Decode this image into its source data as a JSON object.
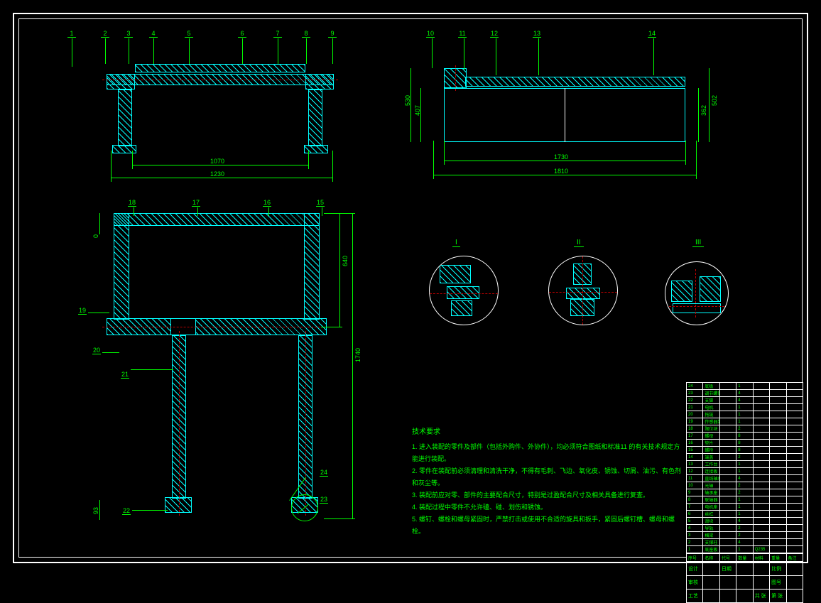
{
  "domain": "Diagram",
  "view_dimensions": {
    "front": {
      "width": "1070",
      "width_overall": "1230"
    },
    "side": {
      "width_inner": "1730",
      "width_overall": "1810",
      "h1": "407",
      "h2": "530",
      "h3": "362",
      "h4": "502"
    },
    "top": {
      "height_overall": "1740",
      "gap": "640",
      "x0": "0",
      "x1": "93"
    }
  },
  "leaders": {
    "front": [
      "1",
      "2",
      "3",
      "4",
      "5",
      "6",
      "7",
      "8",
      "9"
    ],
    "side": [
      "10",
      "11",
      "12",
      "13",
      "14"
    ],
    "top_upper": [
      "18",
      "17",
      "16",
      "15"
    ],
    "top_left": [
      "19",
      "20",
      "21",
      "22"
    ],
    "top_lower_right": [
      "24",
      "23"
    ]
  },
  "detail_labels": [
    "I",
    "II",
    "III"
  ],
  "notes": {
    "title": "技术要求",
    "lines": [
      "1. 进入装配的零件及部件（包括外购件、外协件），均必须符合图纸和标准11 的有关技术规定方能进行装配。",
      "2. 零件在装配前必须清理和清洗干净，不得有毛刺、飞边、氧化皮、锈蚀、切屑、油污、有色剂和灰尘等。",
      "3. 装配前应对零、部件的主要配合尺寸，特别是过盈配合尺寸及相关具备进行复查。",
      "4. 装配过程中零件不允许磕、碰、划伤和锈蚀。",
      "5. 螺钉、螺栓和螺母紧固时，严禁打击或使用不合适的旋具和扳手，紧固后螺钉槽、螺母和螺栓。"
    ]
  },
  "title_block": {
    "bom_rows": [
      [
        "1",
        "底座板",
        "",
        "1",
        "Q235",
        "",
        ""
      ],
      [
        "2",
        "支撑柱",
        "",
        "4",
        "",
        "",
        ""
      ],
      [
        "3",
        "横梁",
        "",
        "2",
        "",
        "",
        ""
      ],
      [
        "4",
        "导轨",
        "",
        "2",
        "",
        "",
        ""
      ],
      [
        "5",
        "滑块",
        "",
        "4",
        "",
        "",
        ""
      ],
      [
        "6",
        "丝杠",
        "",
        "1",
        "",
        "",
        ""
      ],
      [
        "7",
        "电机座",
        "",
        "1",
        "",
        "",
        ""
      ],
      [
        "8",
        "联轴器",
        "",
        "1",
        "",
        "",
        ""
      ],
      [
        "9",
        "轴承座",
        "",
        "2",
        "",
        "",
        ""
      ],
      [
        "10",
        "光轴",
        "",
        "2",
        "",
        "",
        ""
      ],
      [
        "11",
        "直线轴承",
        "",
        "4",
        "",
        "",
        ""
      ],
      [
        "12",
        "连接板",
        "",
        "1",
        "",
        "",
        ""
      ],
      [
        "13",
        "工作台",
        "",
        "1",
        "",
        "",
        ""
      ],
      [
        "14",
        "端盖",
        "",
        "2",
        "",
        "",
        ""
      ],
      [
        "15",
        "螺栓",
        "",
        "8",
        "",
        "",
        ""
      ],
      [
        "16",
        "垫片",
        "",
        "8",
        "",
        "",
        ""
      ],
      [
        "17",
        "螺母",
        "",
        "8",
        "",
        "",
        ""
      ],
      [
        "18",
        "限位块",
        "",
        "2",
        "",
        "",
        ""
      ],
      [
        "19",
        "传感器架",
        "",
        "1",
        "",
        "",
        ""
      ],
      [
        "20",
        "拖链",
        "",
        "1",
        "",
        "",
        ""
      ],
      [
        "21",
        "电机",
        "",
        "1",
        "",
        "",
        ""
      ],
      [
        "22",
        "支脚",
        "",
        "4",
        "",
        "",
        ""
      ],
      [
        "23",
        "调节螺钉",
        "",
        "4",
        "",
        "",
        ""
      ],
      [
        "24",
        "底板",
        "",
        "1",
        "",
        "",
        ""
      ]
    ],
    "bom_header": [
      "序号",
      "名称",
      "代号",
      "数量",
      "材料",
      "重量",
      "备注"
    ],
    "footer": {
      "row1": [
        "设计",
        "",
        "日期",
        "",
        "",
        "比例",
        ""
      ],
      "row2": [
        "审核",
        "",
        "",
        "",
        "",
        "图号",
        ""
      ],
      "row3": [
        "工艺",
        "",
        "",
        "",
        "共  张",
        "第  张",
        ""
      ]
    }
  }
}
